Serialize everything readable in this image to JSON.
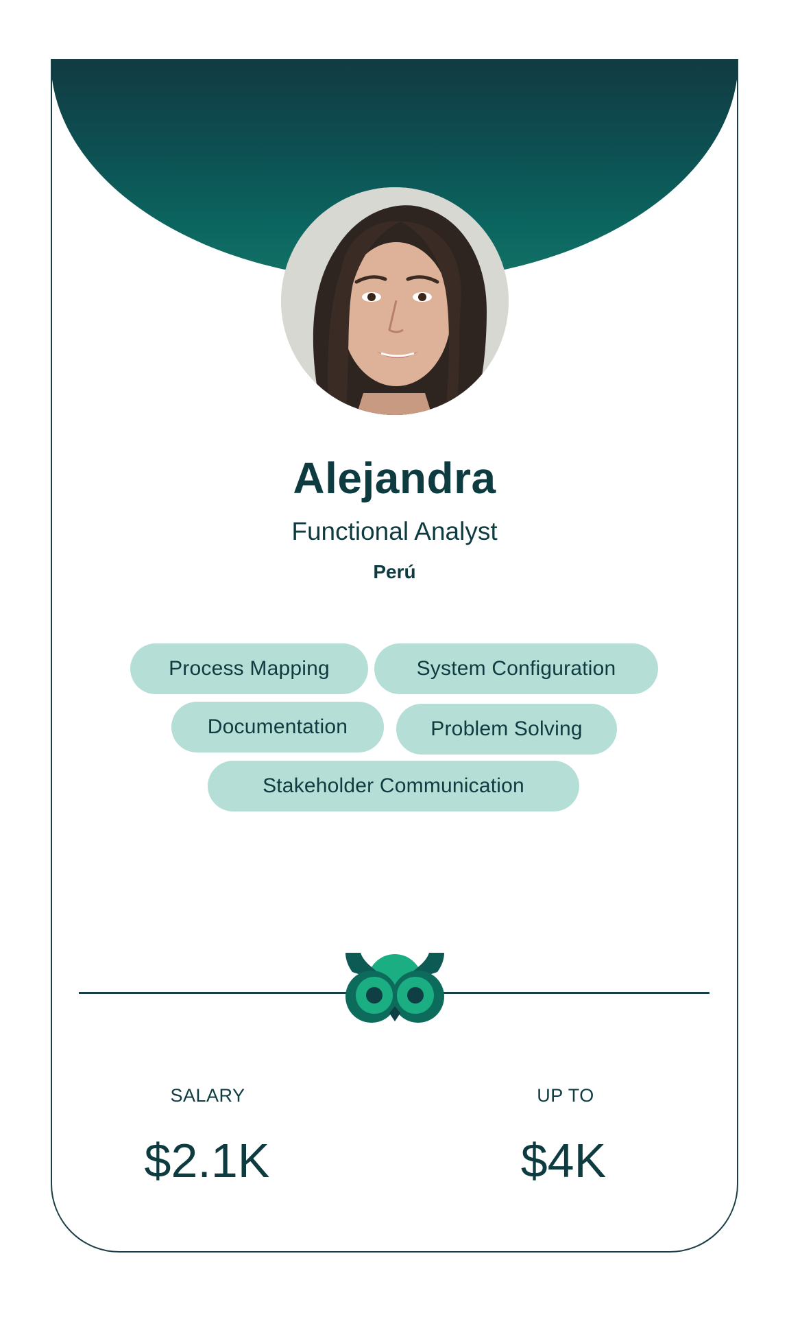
{
  "profile": {
    "name": "Alejandra",
    "role": "Functional Analyst",
    "country": "Perú",
    "photo_alt": "Profile photo of Alejandra"
  },
  "skills": [
    "Process Mapping",
    "System Configuration",
    "Documentation",
    "Problem Solving",
    "Stakeholder Communication"
  ],
  "compensation": {
    "salary_label": "SALARY",
    "salary_value": "$2.1K",
    "max_label": "UP TO",
    "max_value": "$4K"
  },
  "branding": {
    "logo_icon": "owl-logo-icon"
  },
  "colors": {
    "primary_dark": "#0e3b40",
    "header_gradient_top": "#113b42",
    "header_gradient_bottom": "#137266",
    "chip_background": "#b5ded6",
    "owl_light": "#1aae82",
    "owl_dark": "#0d6b5c"
  }
}
